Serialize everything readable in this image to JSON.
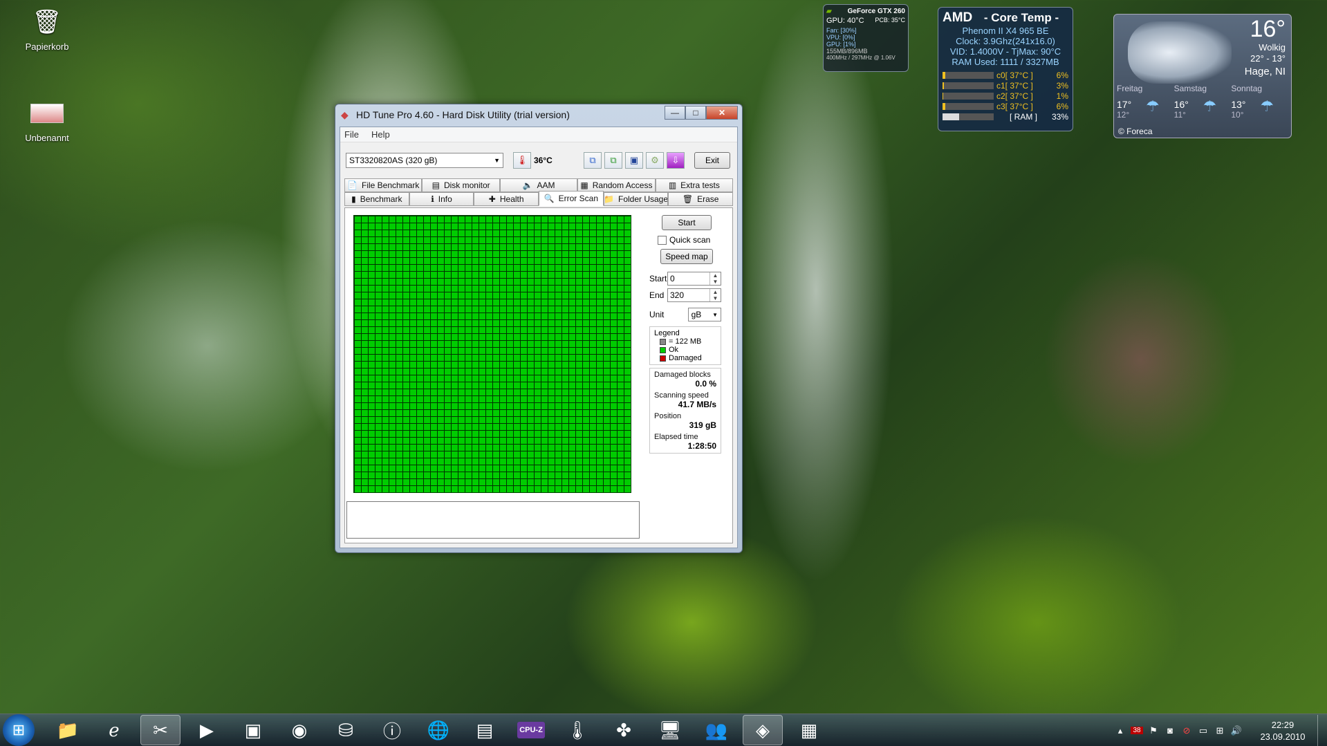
{
  "desktop": {
    "icons": [
      {
        "label": "Papierkorb",
        "icon": "recycle-bin-icon"
      },
      {
        "label": "Unbenannt",
        "icon": "image-file-icon"
      }
    ]
  },
  "window": {
    "title": "HD Tune Pro 4.60 - Hard Disk Utility (trial version)",
    "menu": [
      "File",
      "Help"
    ],
    "drive_select": "ST3320820AS (320 gB)",
    "temperature": "36°C",
    "exit_label": "Exit",
    "tabs_row1": [
      {
        "label": "File Benchmark",
        "icon": "file-benchmark-icon"
      },
      {
        "label": "Disk monitor",
        "icon": "disk-monitor-icon"
      },
      {
        "label": "AAM",
        "icon": "speaker-icon"
      },
      {
        "label": "Random Access",
        "icon": "random-access-icon"
      },
      {
        "label": "Extra tests",
        "icon": "extra-tests-icon"
      }
    ],
    "tabs_row2": [
      {
        "label": "Benchmark",
        "icon": "benchmark-icon"
      },
      {
        "label": "Info",
        "icon": "info-icon"
      },
      {
        "label": "Health",
        "icon": "health-icon"
      },
      {
        "label": "Error Scan",
        "icon": "magnifier-icon",
        "active": true
      },
      {
        "label": "Folder Usage",
        "icon": "folder-icon"
      },
      {
        "label": "Erase",
        "icon": "trash-icon"
      }
    ],
    "error_scan": {
      "start_button": "Start",
      "quick_scan": "Quick scan",
      "quick_scan_checked": false,
      "speed_map_button": "Speed map",
      "start_label": "Start",
      "start_value": "0",
      "end_label": "End",
      "end_value": "320",
      "unit_label": "Unit",
      "unit_value": "gB",
      "legend_title": "Legend",
      "legend": [
        {
          "label": "= 122 MB",
          "color": "#888888"
        },
        {
          "label": "Ok",
          "color": "#00cc00"
        },
        {
          "label": "Damaged",
          "color": "#cc0000"
        }
      ],
      "damaged_blocks_label": "Damaged blocks",
      "damaged_blocks_value": "0.0 %",
      "scanning_speed_label": "Scanning speed",
      "scanning_speed_value": "41.7 MB/s",
      "position_label": "Position",
      "position_value": "319 gB",
      "elapsed_label": "Elapsed time",
      "elapsed_value": "1:28:50",
      "grid_color": "#00cc00"
    }
  },
  "gadgets": {
    "gpu": {
      "name": "GeForce GTX 260",
      "gpu_temp": "GPU: 40°C",
      "pcb_temp": "PCB: 35°C",
      "fan": "Fan: [30%]",
      "vpu": "VPU: [0%]",
      "gpu_load": "GPU: [1%]",
      "memory": "155MB/896MB",
      "clocks": "400MHz / 297MHz @ 1.06V"
    },
    "core_temp": {
      "title": "- Core Temp -",
      "brand": "AMD",
      "cpu": "Phenom II X4 965 BE",
      "clock": "Clock: 3.9Ghz(241x16.0)",
      "vid": "VID: 1.4000V - TjMax: 90°C",
      "ram_used": "RAM Used: 1111 / 3327MB",
      "cores": [
        {
          "label": "c0[ 37°C ]",
          "load": "6%",
          "value": 6
        },
        {
          "label": "c1[ 37°C ]",
          "load": "3%",
          "value": 3
        },
        {
          "label": "c2[ 37°C ]",
          "load": "1%",
          "value": 1
        },
        {
          "label": "c3[ 37°C ]",
          "load": "6%",
          "value": 6
        }
      ],
      "ram_label": "[ RAM ]",
      "ram_percent": "33%",
      "ram_value": 33
    },
    "weather": {
      "temp": "16°",
      "condition": "Wolkig",
      "range": "22° - 13°",
      "city": "Hage, NI",
      "days": [
        {
          "day": "Freitag",
          "high": "17°",
          "low": "12°"
        },
        {
          "day": "Samstag",
          "high": "16°",
          "low": "11°"
        },
        {
          "day": "Sonntag",
          "high": "13°",
          "low": "10°"
        }
      ],
      "provider": "© Foreca"
    }
  },
  "taskbar": {
    "apps": [
      {
        "icon": "explorer-folder-icon",
        "active": false
      },
      {
        "icon": "internet-explorer-icon",
        "active": false
      },
      {
        "icon": "snipping-tool-icon",
        "active": true
      },
      {
        "icon": "media-player-icon",
        "active": false
      },
      {
        "icon": "task-manager-icon",
        "active": false
      },
      {
        "icon": "red-app-icon",
        "active": false
      },
      {
        "icon": "drive-app-icon",
        "active": false
      },
      {
        "icon": "info-app-icon",
        "active": false
      },
      {
        "icon": "globe-icon",
        "active": false
      },
      {
        "icon": "archive-icon",
        "active": false
      },
      {
        "icon": "cpuz-icon",
        "active": false
      },
      {
        "icon": "thermometer-app-icon",
        "active": false
      },
      {
        "icon": "puzzle-app-icon",
        "active": false
      },
      {
        "icon": "network-app-icon",
        "active": false
      },
      {
        "icon": "people-app-icon",
        "active": false
      },
      {
        "icon": "hdtune-icon",
        "active": true
      },
      {
        "icon": "control-panel-icon",
        "active": false
      }
    ],
    "cpuz_label": "CPU-Z",
    "tray_badge": "38",
    "time": "22:29",
    "date": "23.09.2010"
  }
}
